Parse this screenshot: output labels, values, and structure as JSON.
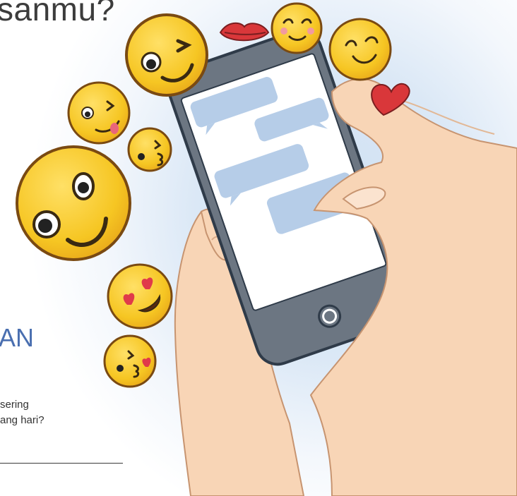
{
  "headline": {
    "text": "sanmu?"
  },
  "section_title": {
    "text": "AN"
  },
  "body_text": {
    "line_1": "sering",
    "line_2": "ang hari?"
  },
  "illustration": {
    "icons": [
      "wink-emoji-icon",
      "blush-emoji-icon",
      "smile-emoji-icon",
      "tongue-wink-emoji-icon",
      "kiss-emoji-icon",
      "heart-eyes-emoji-icon",
      "kiss-heart-emoji-icon",
      "lips-icon",
      "heart-icon",
      "smartphone-icon",
      "chat-bubble-icon",
      "home-button-icon"
    ],
    "colors": {
      "emoji_yellow": "#f6c623",
      "emoji_outline": "#7a4a12",
      "phone_body": "#6c7682",
      "screen": "#ffffff",
      "bubble": "#b6cde8",
      "skin": "#f8d5b6",
      "heart_red": "#d9373a",
      "accent_blue": "#4a6fb0"
    }
  }
}
